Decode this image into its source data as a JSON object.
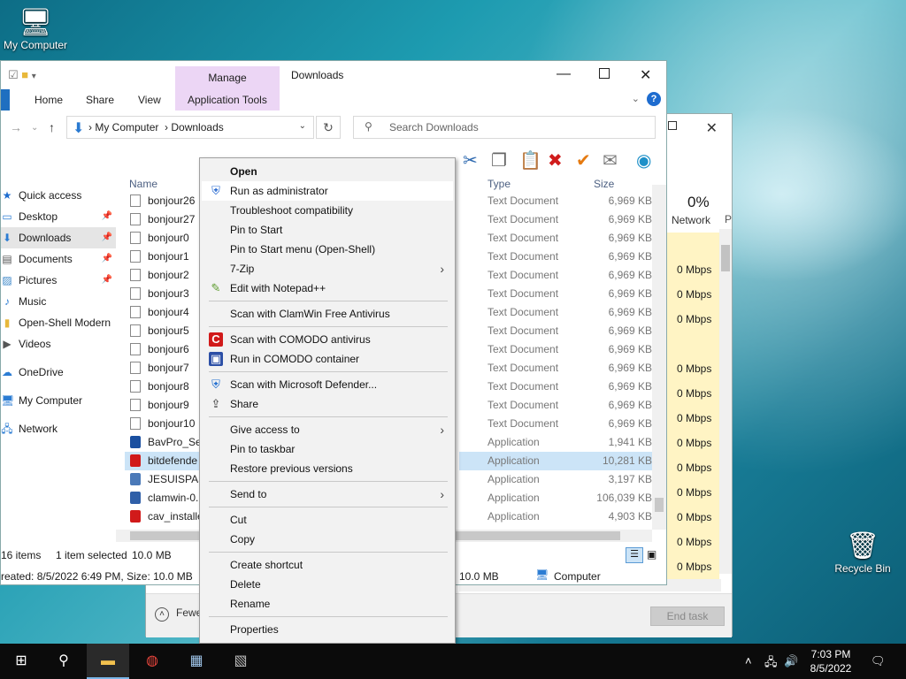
{
  "desktop": {
    "my_computer_label": "My Computer",
    "recycle_bin_label": "Recycle Bin"
  },
  "task_manager": {
    "network_pct": "0%",
    "network_label": "Network",
    "divider_label": "P",
    "rows": [
      "",
      "0 Mbps",
      "0 Mbps",
      "0 Mbps",
      "",
      "0 Mbps",
      "0 Mbps",
      "0 Mbps",
      "0 Mbps",
      "0 Mbps",
      "0 Mbps",
      "0 Mbps",
      "0 Mbps",
      "0 Mbps"
    ],
    "fewer_details": "Fewe",
    "end_task": "End task"
  },
  "explorer": {
    "title": "Downloads",
    "manage_tab": "Manage",
    "ribbon_tabs": [
      "Home",
      "Share",
      "View",
      "Application Tools"
    ],
    "address": {
      "root": "My Computer",
      "folder": "Downloads"
    },
    "search_placeholder": "Search Downloads",
    "columns": {
      "name": "Name",
      "type": "Type",
      "size": "Size"
    },
    "nav": [
      {
        "label": "Quick access",
        "icon": "star-icon",
        "pinned": false
      },
      {
        "label": "Desktop",
        "icon": "desktop-icon",
        "pinned": true
      },
      {
        "label": "Downloads",
        "icon": "download-icon",
        "pinned": true
      },
      {
        "label": "Documents",
        "icon": "documents-icon",
        "pinned": true
      },
      {
        "label": "Pictures",
        "icon": "pictures-icon",
        "pinned": true
      },
      {
        "label": "Music",
        "icon": "music-icon",
        "pinned": false
      },
      {
        "label": "Open-Shell Modern",
        "icon": "folder-icon",
        "pinned": false
      },
      {
        "label": "Videos",
        "icon": "videos-icon",
        "pinned": false
      },
      {
        "label": "OneDrive",
        "icon": "cloud-icon",
        "pinned": false
      },
      {
        "label": "My Computer",
        "icon": "computer-icon",
        "pinned": false
      },
      {
        "label": "Network",
        "icon": "network-icon",
        "pinned": false
      }
    ],
    "files": [
      {
        "name": "bonjour26",
        "type": "Text Document",
        "size": "6,969 KB"
      },
      {
        "name": "bonjour27",
        "type": "Text Document",
        "size": "6,969 KB"
      },
      {
        "name": "bonjour0",
        "type": "Text Document",
        "size": "6,969 KB"
      },
      {
        "name": "bonjour1",
        "type": "Text Document",
        "size": "6,969 KB"
      },
      {
        "name": "bonjour2",
        "type": "Text Document",
        "size": "6,969 KB"
      },
      {
        "name": "bonjour3",
        "type": "Text Document",
        "size": "6,969 KB"
      },
      {
        "name": "bonjour4",
        "type": "Text Document",
        "size": "6,969 KB"
      },
      {
        "name": "bonjour5",
        "type": "Text Document",
        "size": "6,969 KB"
      },
      {
        "name": "bonjour6",
        "type": "Text Document",
        "size": "6,969 KB"
      },
      {
        "name": "bonjour7",
        "type": "Text Document",
        "size": "6,969 KB"
      },
      {
        "name": "bonjour8",
        "type": "Text Document",
        "size": "6,969 KB"
      },
      {
        "name": "bonjour9",
        "type": "Text Document",
        "size": "6,969 KB"
      },
      {
        "name": "bonjour10",
        "type": "Text Document",
        "size": "6,969 KB"
      },
      {
        "name": "BavPro_Set",
        "type": "Application",
        "size": "1,941 KB"
      },
      {
        "name": "bitdefende",
        "type": "Application",
        "size": "10,281 KB"
      },
      {
        "name": "JESUISPASU",
        "type": "Application",
        "size": "3,197 KB"
      },
      {
        "name": "clamwin-0.",
        "type": "Application",
        "size": "106,039 KB"
      },
      {
        "name": "cav_installe",
        "type": "Application",
        "size": "4,903 KB"
      }
    ],
    "status": {
      "items": "16 items",
      "selected": "1 item selected",
      "sel_size": "10.0 MB",
      "details": "reated: 8/5/2022 6:49 PM, Size: 10.0 MB",
      "size2": "10.0 MB",
      "location": "Computer"
    }
  },
  "context_menu": {
    "items": [
      {
        "label": "Open",
        "bold": true
      },
      {
        "label": "Run as administrator",
        "icon": "shield-icon",
        "highlight": true
      },
      {
        "label": "Troubleshoot compatibility"
      },
      {
        "label": "Pin to Start"
      },
      {
        "label": "Pin to Start menu (Open-Shell)"
      },
      {
        "label": "7-Zip",
        "submenu": true
      },
      {
        "label": "Edit with Notepad++",
        "icon": "notepad-icon"
      },
      {
        "sep": true
      },
      {
        "label": "Scan with ClamWin Free Antivirus"
      },
      {
        "sep": true
      },
      {
        "label": "Scan with COMODO antivirus",
        "icon": "comodo-icon"
      },
      {
        "label": "Run in COMODO container",
        "icon": "comodo-container-icon"
      },
      {
        "sep": true
      },
      {
        "label": "Scan with Microsoft Defender...",
        "icon": "defender-icon"
      },
      {
        "label": "Share",
        "icon": "share-icon"
      },
      {
        "sep": true
      },
      {
        "label": "Give access to",
        "submenu": true
      },
      {
        "label": "Pin to taskbar"
      },
      {
        "label": "Restore previous versions"
      },
      {
        "sep": true
      },
      {
        "label": "Send to",
        "submenu": true
      },
      {
        "sep": true
      },
      {
        "label": "Cut"
      },
      {
        "label": "Copy"
      },
      {
        "sep": true
      },
      {
        "label": "Create shortcut"
      },
      {
        "label": "Delete"
      },
      {
        "label": "Rename"
      },
      {
        "sep": true
      },
      {
        "label": "Properties"
      }
    ]
  },
  "taskbar": {
    "time": "7:03 PM",
    "date": "8/5/2022"
  }
}
